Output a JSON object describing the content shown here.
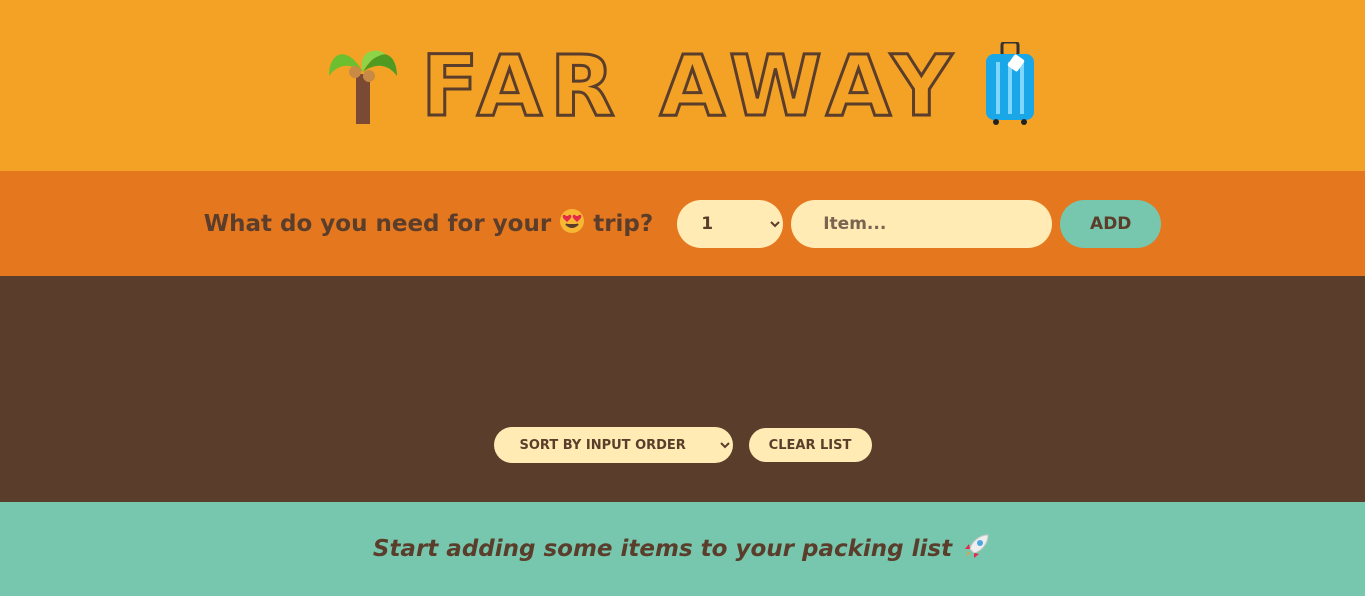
{
  "header": {
    "title": "Far Away",
    "left_icon": "palm-tree-icon",
    "right_icon": "luggage-icon"
  },
  "form": {
    "question_before": "What do you need for your",
    "question_icon": "heart-eyes-icon",
    "question_after": "trip?",
    "quantity_selected": "1",
    "item_placeholder": "Item...",
    "add_label": "Add"
  },
  "list": {
    "sort_selected": "Sort by input order",
    "clear_label": "Clear list"
  },
  "footer": {
    "message": "Start adding some items to your packing list",
    "icon": "rocket-icon"
  },
  "colors": {
    "header_bg": "#f4a226",
    "form_bg": "#e5771f",
    "list_bg": "#5a3e2b",
    "footer_bg": "#76c7ad",
    "field_bg": "#ffebb3",
    "text": "#5a3e2b"
  }
}
